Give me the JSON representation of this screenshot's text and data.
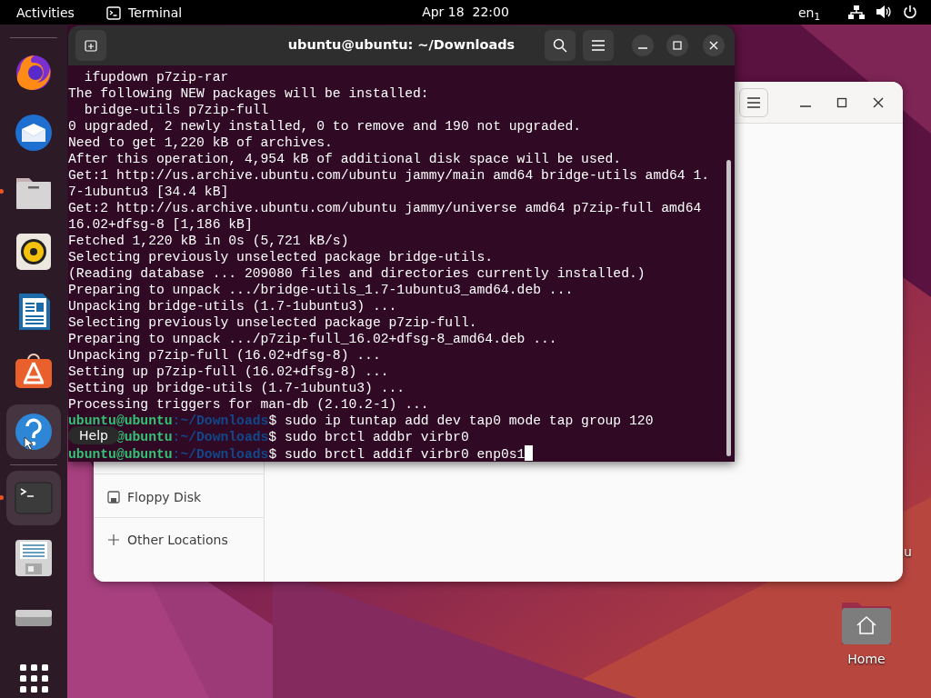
{
  "top_bar": {
    "activities": "Activities",
    "app": "Terminal",
    "clock": "Apr 18  22:00",
    "input_source": "en$_{1}$"
  },
  "dock": {
    "items": [
      {
        "kind": "firefox",
        "running": false,
        "highlighted": false
      },
      {
        "kind": "thunderbird",
        "running": false,
        "highlighted": false
      },
      {
        "kind": "files",
        "running": true,
        "highlighted": false
      },
      {
        "kind": "rhythmbox",
        "running": false,
        "highlighted": false
      },
      {
        "kind": "writer",
        "running": false,
        "highlighted": false
      },
      {
        "kind": "software",
        "running": false,
        "highlighted": false
      },
      {
        "kind": "help",
        "running": false,
        "highlighted": true
      },
      {
        "kind": "separator"
      },
      {
        "kind": "terminal",
        "running": true,
        "highlighted": true
      },
      {
        "kind": "floppy",
        "running": false,
        "highlighted": false
      },
      {
        "kind": "drive",
        "running": false,
        "highlighted": false
      },
      {
        "kind": "apps",
        "running": false,
        "highlighted": false
      }
    ],
    "tooltip": "Help"
  },
  "terminal": {
    "title": "ubuntu@ubuntu: ~/Downloads",
    "lines": [
      {
        "kind": "output",
        "text": "  ifupdown p7zip-rar"
      },
      {
        "kind": "output",
        "text": "The following NEW packages will be installed:"
      },
      {
        "kind": "output",
        "text": "  bridge-utils p7zip-full"
      },
      {
        "kind": "output",
        "text": "0 upgraded, 2 newly installed, 0 to remove and 190 not upgraded."
      },
      {
        "kind": "output",
        "text": "Need to get 1,220 kB of archives."
      },
      {
        "kind": "output",
        "text": "After this operation, 4,954 kB of additional disk space will be used."
      },
      {
        "kind": "output",
        "text": "Get:1 http://us.archive.ubuntu.com/ubuntu jammy/main amd64 bridge-utils amd64 1."
      },
      {
        "kind": "output",
        "text": "7-1ubuntu3 [34.4 kB]"
      },
      {
        "kind": "output",
        "text": "Get:2 http://us.archive.ubuntu.com/ubuntu jammy/universe amd64 p7zip-full amd64"
      },
      {
        "kind": "output",
        "text": "16.02+dfsg-8 [1,186 kB]"
      },
      {
        "kind": "output",
        "text": "Fetched 1,220 kB in 0s (5,721 kB/s)"
      },
      {
        "kind": "output",
        "text": "Selecting previously unselected package bridge-utils."
      },
      {
        "kind": "output",
        "text": "(Reading database ... 209080 files and directories currently installed.)"
      },
      {
        "kind": "output",
        "text": "Preparing to unpack .../bridge-utils_1.7-1ubuntu3_amd64.deb ..."
      },
      {
        "kind": "output",
        "text": "Unpacking bridge-utils (1.7-1ubuntu3) ..."
      },
      {
        "kind": "output",
        "text": "Selecting previously unselected package p7zip-full."
      },
      {
        "kind": "output",
        "text": "Preparing to unpack .../p7zip-full_16.02+dfsg-8_amd64.deb ..."
      },
      {
        "kind": "output",
        "text": "Unpacking p7zip-full (16.02+dfsg-8) ..."
      },
      {
        "kind": "output",
        "text": "Setting up p7zip-full (16.02+dfsg-8) ..."
      },
      {
        "kind": "output",
        "text": "Setting up bridge-utils (1.7-1ubuntu3) ..."
      },
      {
        "kind": "output",
        "text": "Processing triggers for man-db (2.10.2-1) ..."
      },
      {
        "kind": "prompt",
        "user": "ubuntu@ubuntu",
        "path": ":~/Downloads",
        "command": "$ sudo ip tuntap add dev tap0 mode tap group 120",
        "cursor": false
      },
      {
        "kind": "prompt",
        "user": "@ubuntu",
        "path": ":~/Downloads",
        "command": "$ sudo brctl addbr virbr0",
        "cursor": false
      },
      {
        "kind": "prompt",
        "user": "ubuntu@ubuntu",
        "path": ":~/Downloads",
        "command": "$ sudo brctl addif virbr0 enp0s1",
        "cursor": true
      }
    ]
  },
  "files": {
    "sidebar": [
      {
        "kind": "drive",
        "label": "Floppy Disk"
      },
      {
        "kind": "other",
        "label": "Other Locations"
      }
    ]
  },
  "desktop_icons": [
    {
      "kind": "hidden",
      "label": "u"
    },
    {
      "kind": "home",
      "label": "Home"
    }
  ]
}
